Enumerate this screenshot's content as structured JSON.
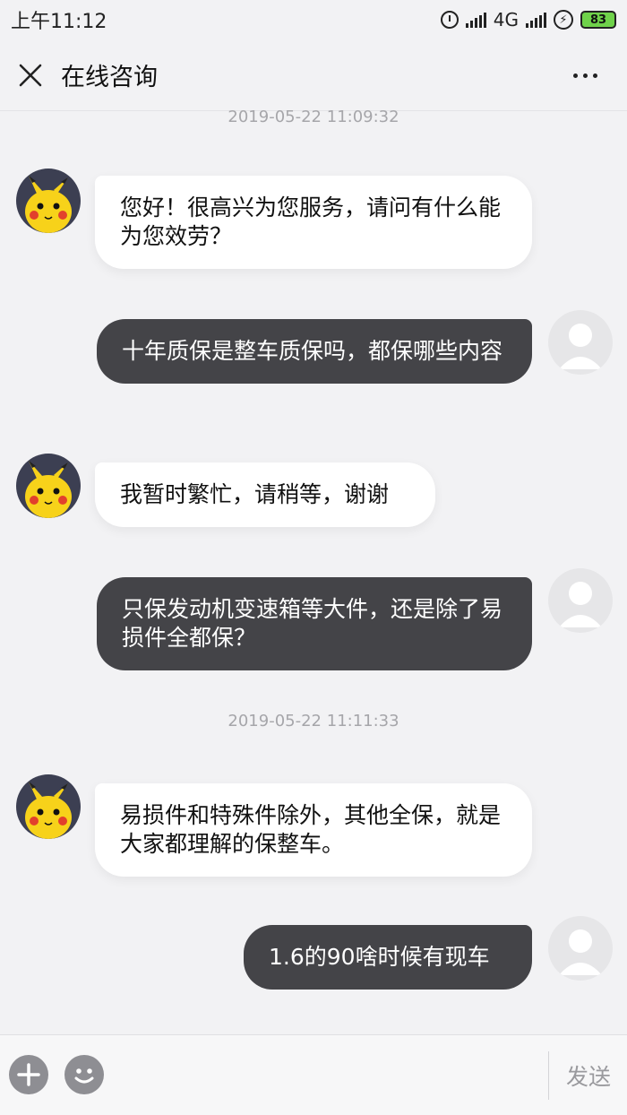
{
  "status_bar": {
    "time": "上午11:12",
    "network": "4G",
    "battery": "83"
  },
  "header": {
    "title": "在线咨询"
  },
  "messages": [
    {
      "type": "timestamp",
      "text": "2019-05-22 11:09:32"
    },
    {
      "type": "agent",
      "text": "您好！很高兴为您服务，请问有什么能为您效劳？"
    },
    {
      "type": "user",
      "text": "十年质保是整车质保吗，都保哪些内容"
    },
    {
      "type": "agent",
      "text": "我暂时繁忙，请稍等，谢谢"
    },
    {
      "type": "user",
      "text": "只保发动机变速箱等大件，还是除了易损件全都保？"
    },
    {
      "type": "timestamp",
      "text": "2019-05-22 11:11:33"
    },
    {
      "type": "agent",
      "text": "易损件和特殊件除外，其他全保，就是大家都理解的保整车。"
    },
    {
      "type": "user",
      "text": "1.6的90啥时候有现车"
    }
  ],
  "input_bar": {
    "send_label": "发送"
  },
  "icons": {
    "close": "close-icon",
    "more": "more-icon",
    "agent_avatar": "pikachu-avatar",
    "user_avatar": "default-user-avatar",
    "add": "plus-icon",
    "emoji": "emoji-icon"
  },
  "colors": {
    "background": "#f2f2f4",
    "user_bubble": "#444448",
    "agent_bubble": "#ffffff",
    "timestamp": "#a6a6aa",
    "battery": "#6fd24a"
  }
}
